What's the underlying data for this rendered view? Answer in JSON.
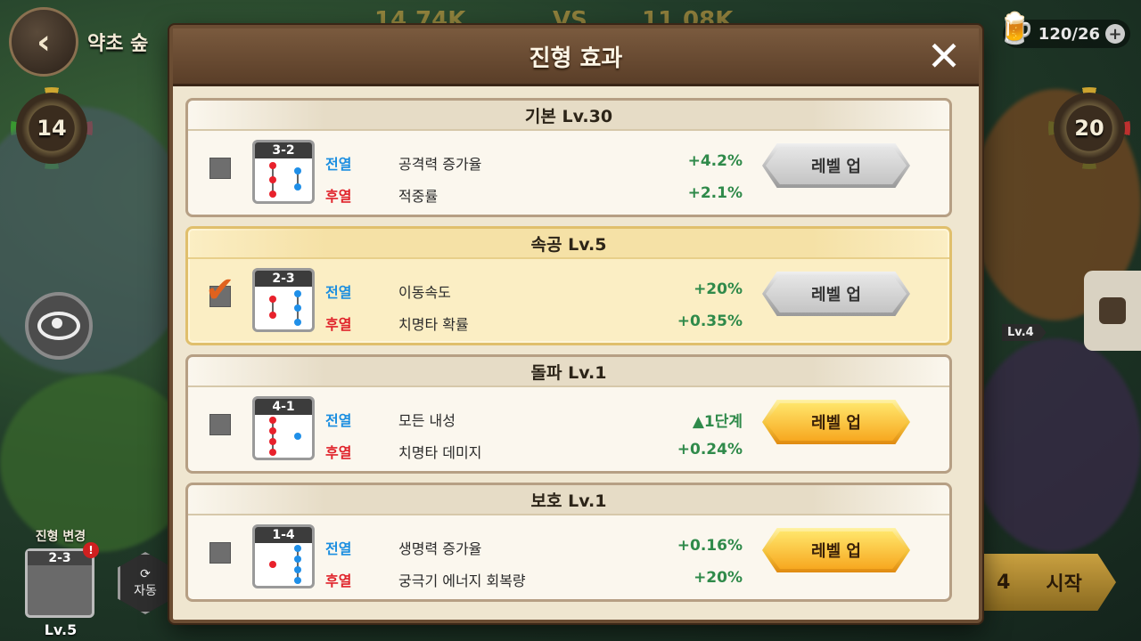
{
  "top": {
    "stage_name": "약초 숲",
    "score_left": "14.74K",
    "vs": "VS",
    "score_right": "11.08K",
    "resource": "120/26"
  },
  "left_hud": {
    "compass_level": "14",
    "formation_change_label": "진형 변경",
    "formation_code": "2-3",
    "formation_badge": "!",
    "formation_level": "Lv.5",
    "auto_label": "자동"
  },
  "right_hud": {
    "compass_level": "20",
    "enemy_level_tag": "Lv.4",
    "start_count": "4",
    "start_label": "시작"
  },
  "modal": {
    "title": "진형 효과",
    "close_icon": "close-icon",
    "cards": [
      {
        "title": "기본 Lv.30",
        "checked": false,
        "code": "3-2",
        "front_label": "전열",
        "back_label": "후열",
        "front_stat": "공격력 증가율",
        "front_value": "+4.2%",
        "back_stat": "적중률",
        "back_value": "+2.1%",
        "button_label": "레벨 업",
        "button_style": "gray"
      },
      {
        "title": "속공 Lv.5",
        "checked": true,
        "code": "2-3",
        "front_label": "전열",
        "back_label": "후열",
        "front_stat": "이동속도",
        "front_value": "+20%",
        "back_stat": "치명타 확률",
        "back_value": "+0.35%",
        "button_label": "레벨 업",
        "button_style": "gray"
      },
      {
        "title": "돌파 Lv.1",
        "checked": false,
        "code": "4-1",
        "front_label": "전열",
        "back_label": "후열",
        "front_stat": "모든 내성",
        "front_value": "▲1단계",
        "back_stat": "치명타 데미지",
        "back_value": "+0.24%",
        "button_label": "레벨 업",
        "button_style": "gold"
      },
      {
        "title": "보호 Lv.1",
        "checked": false,
        "code": "1-4",
        "front_label": "전열",
        "back_label": "후열",
        "front_stat": "생명력 증가율",
        "front_value": "+0.16%",
        "back_stat": "궁극기 에너지 회복량",
        "back_value": "+20%",
        "button_label": "레벨 업",
        "button_style": "gold"
      }
    ]
  },
  "colors": {
    "front": "#1b8ee0",
    "back": "#e0222a",
    "value": "#2f8a4a",
    "header": "#6b4d33",
    "active_card": "#fbeec4"
  }
}
